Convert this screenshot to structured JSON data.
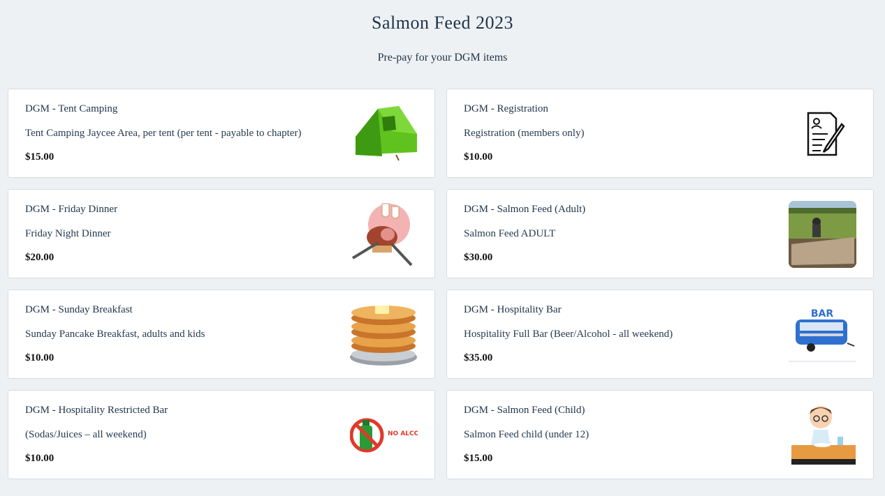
{
  "header": {
    "title": "Salmon Feed 2023",
    "subtitle": "Pre-pay for your DGM items"
  },
  "products": [
    {
      "name": "DGM - Tent Camping",
      "description": "Tent Camping Jaycee Area, per tent (per tent - payable to chapter)",
      "price": "$15.00",
      "icon": "tent-icon"
    },
    {
      "name": "DGM - Registration",
      "description": "Registration (members only)",
      "price": "$10.00",
      "icon": "registration-form-icon"
    },
    {
      "name": "DGM - Friday Dinner",
      "description": "Friday Night Dinner",
      "price": "$20.00",
      "icon": "roast-dinner-icon"
    },
    {
      "name": "DGM - Salmon Feed (Adult)",
      "description": "Salmon Feed ADULT",
      "price": "$30.00",
      "icon": "salmon-grill-photo"
    },
    {
      "name": "DGM - Sunday Breakfast",
      "description": "Sunday Pancake Breakfast, adults and kids",
      "price": "$10.00",
      "icon": "pancakes-icon"
    },
    {
      "name": "DGM - Hospitality Bar",
      "description": "Hospitality Full Bar (Beer/Alcohol - all weekend)",
      "price": "$35.00",
      "icon": "bar-trailer-icon",
      "image_text": "BAR"
    },
    {
      "name": "DGM - Hospitality Restricted Bar",
      "description": "(Sodas/Juices – all weekend)",
      "price": "$10.00",
      "icon": "no-alcohol-icon",
      "image_text": "NO ALCOHOL"
    },
    {
      "name": "DGM - Salmon Feed (Child)",
      "description": "Salmon Feed child (under 12)",
      "price": "$15.00",
      "icon": "child-eating-icon"
    }
  ]
}
